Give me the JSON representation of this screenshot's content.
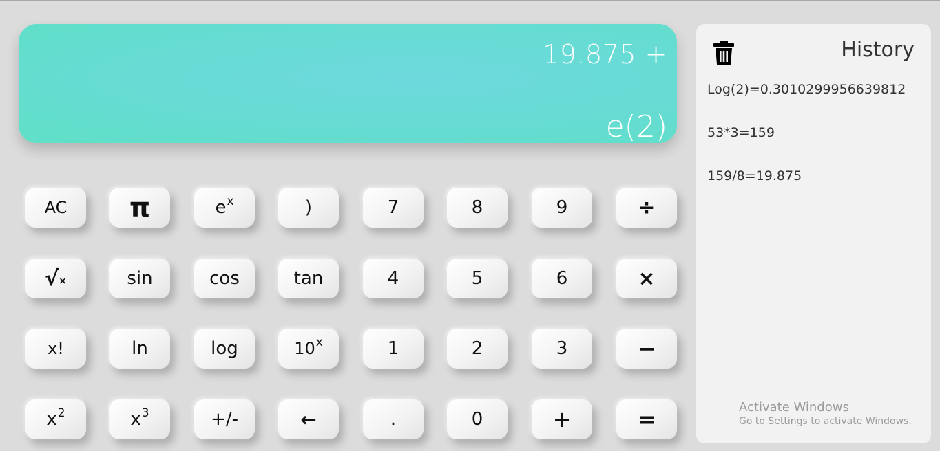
{
  "display": {
    "expression": "19.875 +",
    "current": "e(2)"
  },
  "keys": {
    "r1": {
      "ac": "AC",
      "pi": "π",
      "ex_base": "e",
      "ex_sup": "x",
      "rparen": ")",
      "k7": "7",
      "k8": "8",
      "k9": "9",
      "divide": "÷"
    },
    "r2": {
      "sqrt": "√×",
      "sin": "sin",
      "cos": "cos",
      "tan": "tan",
      "k4": "4",
      "k5": "5",
      "k6": "6",
      "multiply": "×"
    },
    "r3": {
      "fact": "x!",
      "ln": "ln",
      "log": "log",
      "tenx_base": "10",
      "tenx_sup": "x",
      "k1": "1",
      "k2": "2",
      "k3": "3",
      "minus": "−"
    },
    "r4": {
      "sq_base": "x",
      "sq_sup": "2",
      "cube_base": "x",
      "cube_sup": "3",
      "negate": "+/-",
      "back": "←",
      "dot": ".",
      "k0": "0",
      "plus": "+",
      "equals": "="
    }
  },
  "history": {
    "title": "History",
    "entries": [
      "Log(2)=0.3010299956639812",
      "53*3=159",
      "159/8=19.875"
    ],
    "icon": "trash-icon"
  },
  "watermark": {
    "line1": "Activate Windows",
    "line2": "Go to Settings to activate Windows."
  },
  "colors": {
    "display_accent": "#66dcd3",
    "background": "#dcdcdc"
  }
}
